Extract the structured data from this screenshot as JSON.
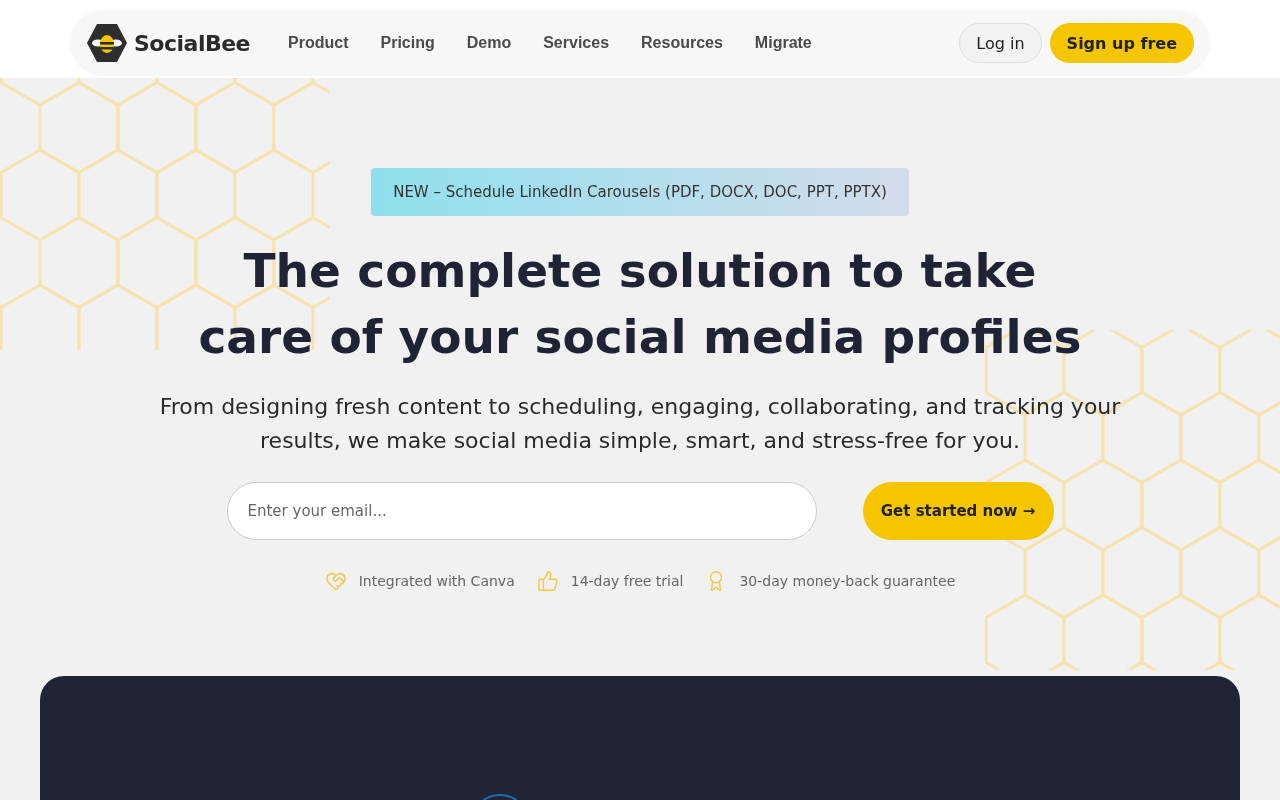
{
  "nav": {
    "brand": "SocialBee",
    "links": [
      "Product",
      "Pricing",
      "Demo",
      "Services",
      "Resources",
      "Migrate"
    ],
    "login": "Log in",
    "signup": "Sign up free"
  },
  "hero": {
    "announcement": "NEW – Schedule LinkedIn Carousels (PDF, DOCX, DOC, PPT, PPTX)",
    "title_lines": [
      "The complete solution to take",
      "care of your social media profiles"
    ],
    "subtitle": "From designing fresh content to scheduling, engaging, collaborating, and tracking your results, we make social media simple, smart, and stress-free for you.",
    "email": {
      "placeholder": "Enter your email..."
    },
    "cta": "Get started now →",
    "features": [
      {
        "kind": "handshake",
        "label": "Integrated with Canva"
      },
      {
        "kind": "thumb",
        "label": "14-day free trial"
      },
      {
        "kind": "award",
        "label": "30-day money-back guarantee"
      }
    ]
  }
}
